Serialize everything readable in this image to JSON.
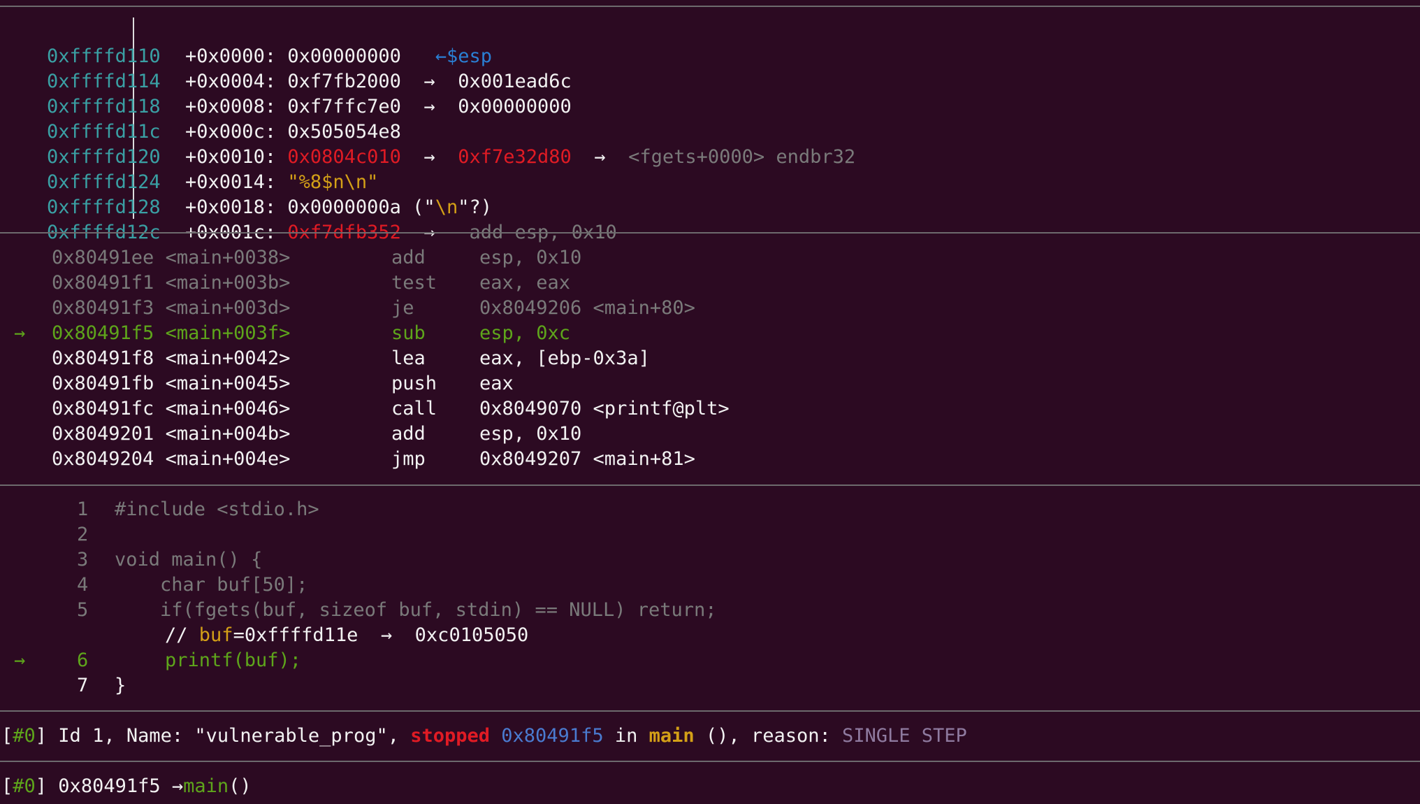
{
  "stack": {
    "rows": [
      {
        "addr": "0xffffd110",
        "offset": "+0x0000:",
        "value": "0x00000000",
        "arrow": "←",
        "target": "$esp",
        "extra": ""
      },
      {
        "addr": "0xffffd114",
        "offset": "+0x0004:",
        "value": "0xf7fb2000",
        "arrow": "→",
        "target": "0x001ead6c",
        "extra": ""
      },
      {
        "addr": "0xffffd118",
        "offset": "+0x0008:",
        "value": "0xf7ffc7e0",
        "arrow": "→",
        "target": "0x00000000",
        "extra": ""
      },
      {
        "addr": "0xffffd11c",
        "offset": "+0x000c:",
        "value": "0x505054e8",
        "arrow": "",
        "target": "",
        "extra": ""
      },
      {
        "addr": "0xffffd120",
        "offset": "+0x0010:",
        "value": "0x0804c010",
        "arrow": "→",
        "target": "0xf7e32d80",
        "arrow2": "→",
        "extra": "<fgets+0000> endbr32"
      },
      {
        "addr": "0xffffd124",
        "offset": "+0x0014:",
        "value": "\"%8$n\\n\"",
        "arrow": "",
        "target": "",
        "extra": ""
      },
      {
        "addr": "0xffffd128",
        "offset": "+0x0018:",
        "value": "0x0000000a",
        "paren_open": "(\"",
        "escape": "\\n",
        "paren_close": "\"?)",
        "arrow": "",
        "target": "",
        "extra": ""
      },
      {
        "addr": "0xffffd12c",
        "offset": "+0x001c:",
        "value": "0xf7dfb352",
        "arrow": "→",
        "target": "",
        "extra": "add esp, 0x10"
      }
    ]
  },
  "disasm": {
    "current_arrow": "→",
    "rows": [
      {
        "addr": "0x80491ee",
        "sym": "<main+0038>",
        "mnem": "add",
        "ops": "esp, 0x10",
        "state": "past"
      },
      {
        "addr": "0x80491f1",
        "sym": "<main+003b>",
        "mnem": "test",
        "ops": "eax, eax",
        "state": "past"
      },
      {
        "addr": "0x80491f3",
        "sym": "<main+003d>",
        "mnem": "je",
        "ops": "0x8049206 <main+80>",
        "state": "past"
      },
      {
        "addr": "0x80491f5",
        "sym": "<main+003f>",
        "mnem": "sub",
        "ops": "esp, 0xc",
        "state": "current"
      },
      {
        "addr": "0x80491f8",
        "sym": "<main+0042>",
        "mnem": "lea",
        "ops": "eax, [ebp-0x3a]",
        "state": "next"
      },
      {
        "addr": "0x80491fb",
        "sym": "<main+0045>",
        "mnem": "push",
        "ops": "eax",
        "state": "next"
      },
      {
        "addr": "0x80491fc",
        "sym": "<main+0046>",
        "mnem": "call",
        "ops": "0x8049070 <printf@plt>",
        "state": "next"
      },
      {
        "addr": "0x8049201",
        "sym": "<main+004b>",
        "mnem": "add",
        "ops": "esp, 0x10",
        "state": "next"
      },
      {
        "addr": "0x8049204",
        "sym": "<main+004e>",
        "mnem": "jmp",
        "ops": "0x8049207 <main+81>",
        "state": "next"
      }
    ]
  },
  "source": {
    "current_arrow": "→",
    "lines": [
      {
        "num": "1",
        "code": "#include <stdio.h>",
        "state": "past"
      },
      {
        "num": "2",
        "code": "",
        "state": "past"
      },
      {
        "num": "3",
        "code": "void main() {",
        "state": "past"
      },
      {
        "num": "4",
        "code": "    char buf[50];",
        "state": "past"
      },
      {
        "num": "5",
        "code": "    if(fgets(buf, sizeof buf, stdin) == NULL) return;",
        "state": "past"
      }
    ],
    "comment": {
      "prefix": "// ",
      "var": "buf",
      "rest": "=0xffffd11e",
      "arrow": "→",
      "value": "0xc0105050"
    },
    "current": {
      "num": "6",
      "code": "printf(buf);"
    },
    "after": {
      "num": "7",
      "code": "}"
    }
  },
  "threads": {
    "tag": "[#0]",
    "pre": " Id 1, Name: \"vulnerable_prog\", ",
    "state": "stopped",
    "addr": "0x80491f5",
    "in": " in ",
    "func": "main",
    "post": " (), reason: ",
    "reason": "SINGLE STEP"
  },
  "trace": {
    "tag": "[#0]",
    "addr": " 0x80491f5 ",
    "arrow": "→",
    "func": "main",
    "parens": "()"
  }
}
